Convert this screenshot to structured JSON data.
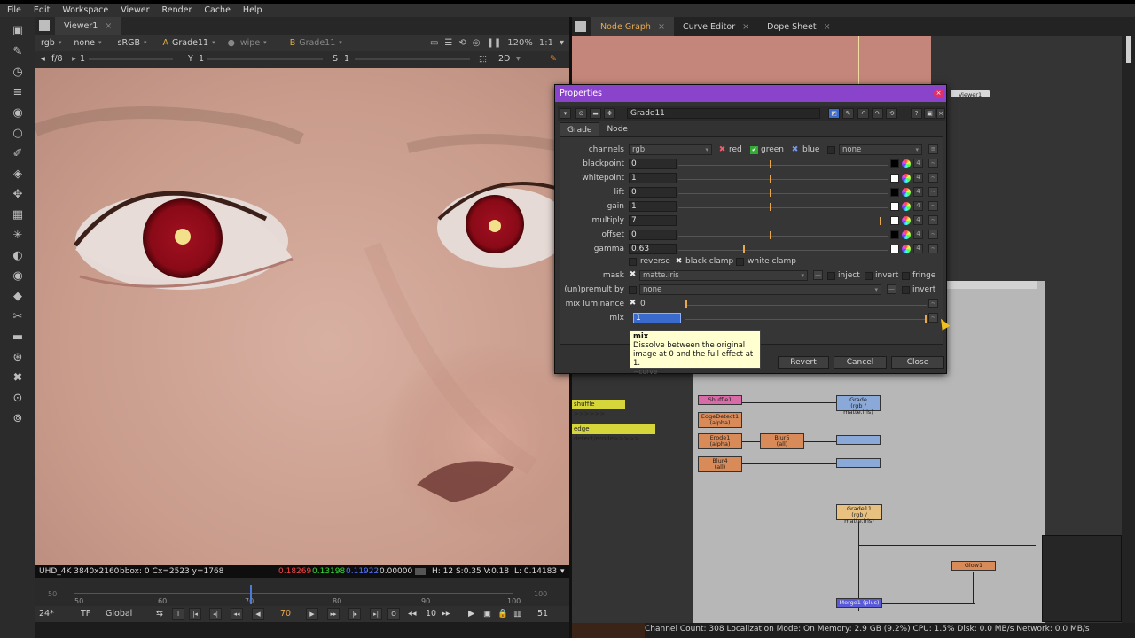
{
  "menu": [
    "File",
    "Edit",
    "Workspace",
    "Viewer",
    "Render",
    "Cache",
    "Help"
  ],
  "viewer": {
    "tab_label": "Viewer1",
    "channels": "rgb",
    "alpha": "none",
    "colorspace": "sRGB",
    "input_a_label": "A",
    "input_a": "Grade11",
    "wipe": "wipe",
    "input_b_label": "B",
    "input_b": "Grade11",
    "zoom": "120%",
    "proxy": "1:1",
    "fstop": "f/8",
    "gain_value": "1",
    "y_label": "Y",
    "gamma_value": "1",
    "s_label": "S",
    "s_value": "1",
    "view_mode": "2D",
    "status": {
      "format": "UHD_4K 3840x2160",
      "bbox": "bbox: 0 C",
      "coords": "x=2523 y=1768",
      "r": "0.18269",
      "g": "0.13198",
      "b": "0.11922",
      "a": "0.00000",
      "hsv": "H: 12 S:0.35 V:0.18",
      "lum": "L: 0.14183"
    },
    "timeline": {
      "ticks": [
        "50",
        "60",
        "70",
        "80",
        "90",
        "100"
      ],
      "start": "50",
      "end": "100",
      "current_fraction": 0.4
    },
    "playbar": {
      "fps": "24*",
      "tf": "TF",
      "scope": "Global",
      "frame": "70",
      "step": "10",
      "end_frame": "51"
    }
  },
  "node_graph": {
    "tabs": [
      "Node Graph",
      "Curve Editor",
      "Dope Sheet"
    ],
    "labels": {
      "shuffle": "shuffle >>>>>>",
      "edge": "edge detect/erode>>>>>"
    },
    "nodes": {
      "viewer": "Viewer1",
      "shuffle1": "Shuffle1",
      "edgedetect1": "EdgeDetect1\n(alpha)",
      "erode1": "Erode1\n(alpha)",
      "blur5": "Blur5\n(all)",
      "blur4": "Blur4\n(all)",
      "grade_top": "Grade\n(rgb / matte.iris)",
      "grade11": "Grade11\n(rgb / matte.iris)",
      "glow1": "Glow1",
      "merge1": "Merge1 (plus)"
    },
    "status_bar": "Channel Count: 308  Localization Mode: On  Memory: 2.9 GB (9.2%)  CPU: 1.5%  Disk: 0.0 MB/s  Network: 0.0 MB/s"
  },
  "properties": {
    "title": "Properties",
    "node_name": "Grade11",
    "tabs": [
      "Grade",
      "Node"
    ],
    "channels": {
      "label": "channels",
      "value": "rgb",
      "red": "red",
      "green": "green",
      "blue": "blue",
      "extra": "none"
    },
    "knobs": [
      {
        "label": "blackpoint",
        "value": "0",
        "knob": 0.44
      },
      {
        "label": "whitepoint",
        "value": "1",
        "knob": 0.44
      },
      {
        "label": "lift",
        "value": "0",
        "knob": 0.44
      },
      {
        "label": "gain",
        "value": "1",
        "knob": 0.44
      },
      {
        "label": "multiply",
        "value": "7",
        "knob": 0.97
      },
      {
        "label": "offset",
        "value": "0",
        "knob": 0.44
      },
      {
        "label": "gamma",
        "value": "0.63",
        "knob": 0.31
      }
    ],
    "clamps": {
      "reverse": "reverse",
      "black": "black clamp",
      "white": "white clamp"
    },
    "mask": {
      "label": "mask",
      "value": "matte.iris",
      "inject": "inject",
      "invert": "invert",
      "fringe": "fringe"
    },
    "unpremult": {
      "label": "(un)premult by",
      "value": "none",
      "invert": "invert"
    },
    "mix_luminance": {
      "label": "mix luminance",
      "value": "0"
    },
    "mix": {
      "label": "mix",
      "value": "1"
    },
    "tooltip": {
      "title": "mix",
      "body": "Dissolve between the original image at 0 and the full effect at 1.",
      "hint": "~curve"
    },
    "buttons": {
      "revert": "Revert",
      "cancel": "Cancel",
      "close": "Close"
    }
  }
}
